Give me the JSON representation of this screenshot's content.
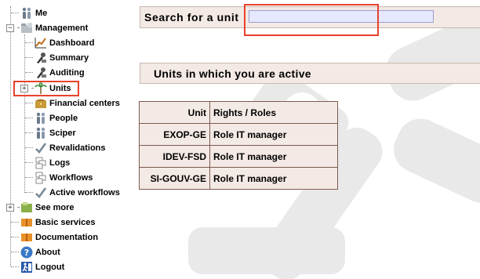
{
  "sidebar": {
    "items": [
      {
        "label": "Me",
        "icon": "users-icon"
      },
      {
        "label": "Management",
        "icon": "folder-icon"
      },
      {
        "label": "Dashboard",
        "icon": "chart-icon"
      },
      {
        "label": "Summary",
        "icon": "tools-icon"
      },
      {
        "label": "Auditing",
        "icon": "tools-icon"
      },
      {
        "label": "Units",
        "icon": "palm-tree-icon"
      },
      {
        "label": "Financial centers",
        "icon": "chest-icon"
      },
      {
        "label": "People",
        "icon": "users-icon"
      },
      {
        "label": "Sciper",
        "icon": "users-icon"
      },
      {
        "label": "Revalidations",
        "icon": "checkmark-icon"
      },
      {
        "label": "Logs",
        "icon": "pages-icon"
      },
      {
        "label": "Workflows",
        "icon": "pages-icon"
      },
      {
        "label": "Active workflows",
        "icon": "checkmark-icon"
      },
      {
        "label": "See more",
        "icon": "folder-icon"
      },
      {
        "label": "Basic services",
        "icon": "book-icon"
      },
      {
        "label": "Documentation",
        "icon": "book-icon"
      },
      {
        "label": "About",
        "icon": "help-icon"
      },
      {
        "label": "Logout",
        "icon": "logout-icon"
      }
    ]
  },
  "search": {
    "label": "Search for a unit",
    "value": "",
    "placeholder": ""
  },
  "units": {
    "title": "Units in which you are active",
    "columns": [
      "Unit",
      "Rights / Roles"
    ],
    "rows": [
      [
        "EXOP-GE",
        "Role IT manager"
      ],
      [
        "IDEV-FSD",
        "Role IT manager"
      ],
      [
        "SI-GOUV-GE",
        "Role IT manager"
      ]
    ]
  },
  "colors": {
    "highlight": "#e8412c",
    "bar_bg": "#f3e9e5",
    "table_border": "#7d5a4f",
    "input_bg": "#e6e8ff"
  }
}
